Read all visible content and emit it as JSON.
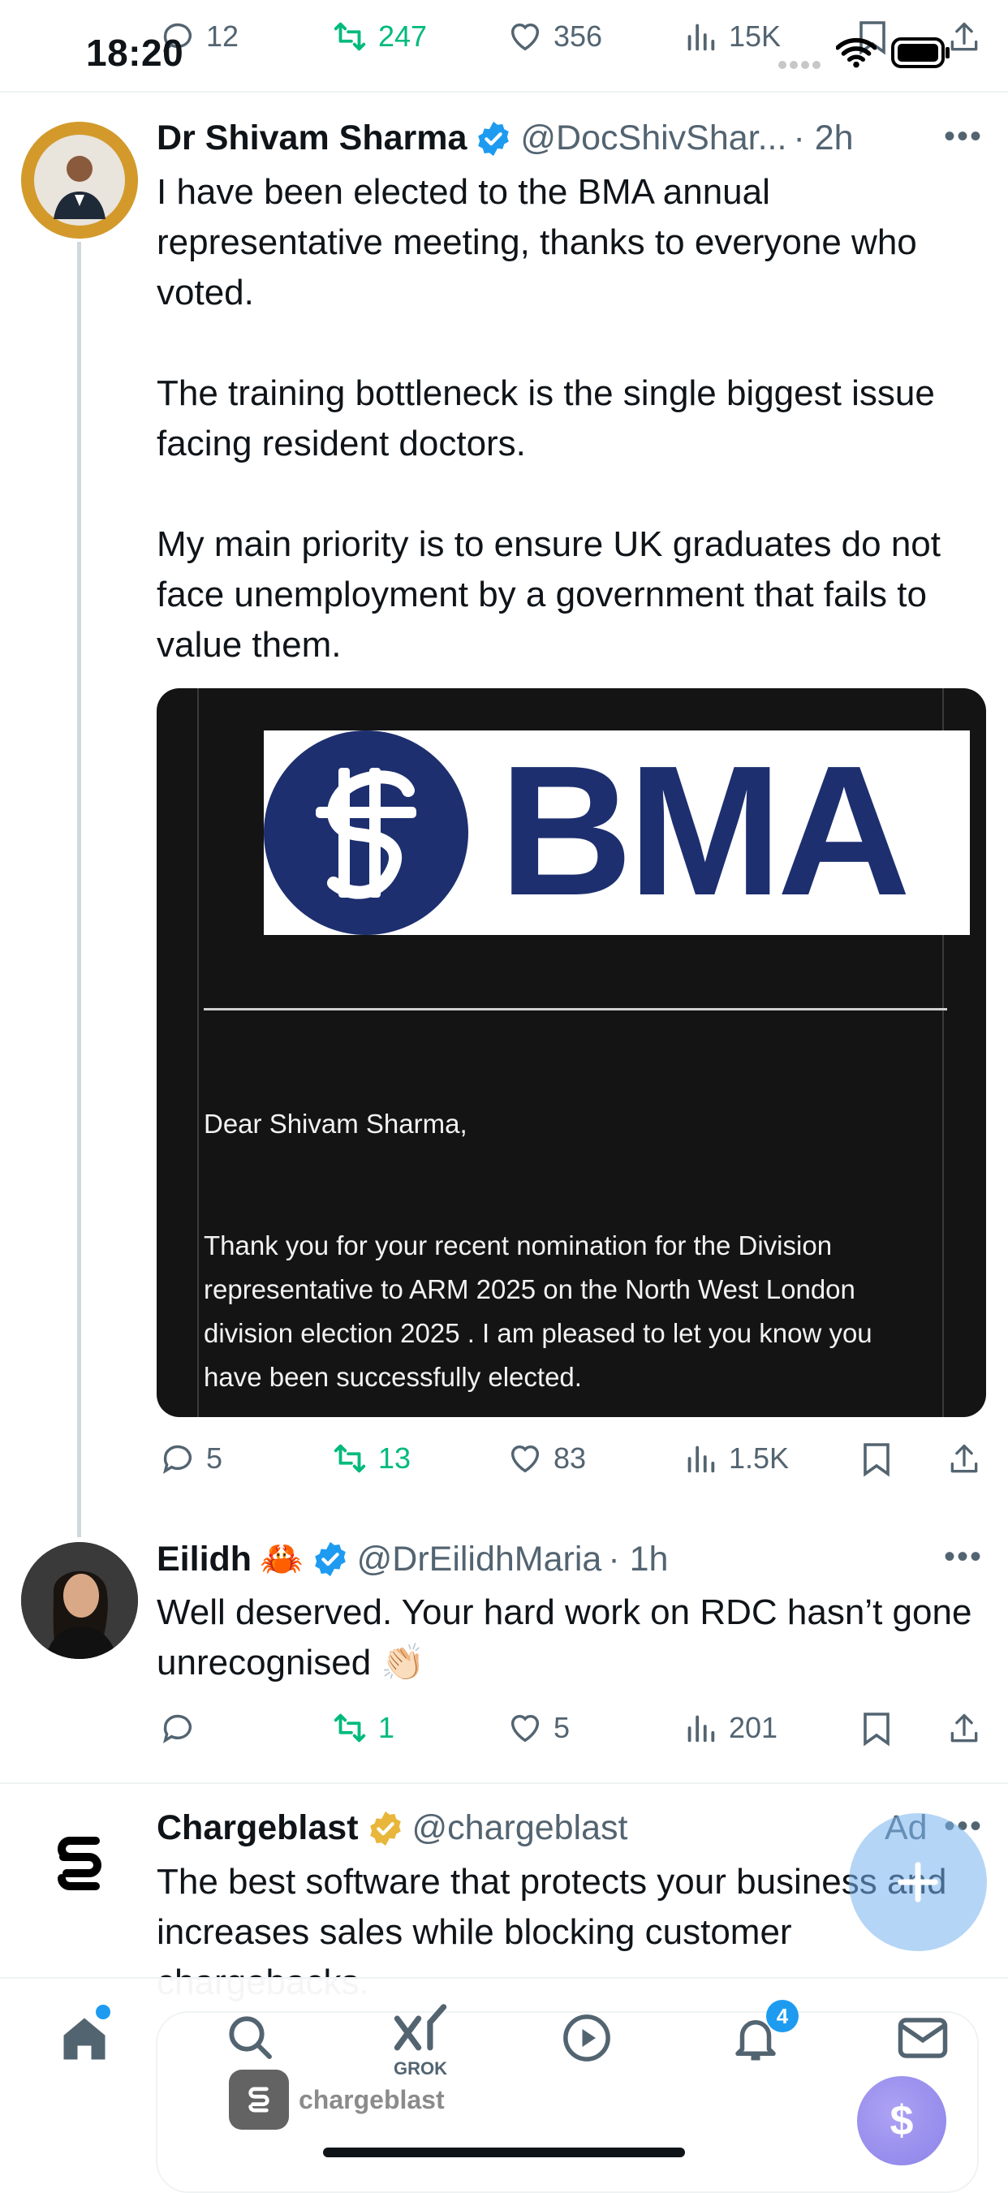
{
  "status_bar": {
    "time": "18:20"
  },
  "top_actions": {
    "replies": "12",
    "reposts": "247",
    "likes": "356",
    "views": "15K"
  },
  "posts": [
    {
      "name": "Dr Shivam Sharma",
      "handle": "@DocShivShar...",
      "time": "· 2h",
      "text": "I have been elected to the BMA annual representative meeting, thanks to everyone who voted.\n\nThe training bottleneck is the single biggest issue facing resident doctors.\n\nMy main priority is to ensure UK graduates do not face unemployment by a government that fails to value them.",
      "media": {
        "logo_text": "BMA",
        "greeting": "Dear Shivam Sharma,",
        "body_lines": [
          "Thank you for your recent nomination for the Division",
          "representative to ARM 2025 on the North West London",
          "division election 2025 . I am pleased to let you know you",
          "have been successfully elected."
        ]
      },
      "actions": {
        "replies": "5",
        "reposts": "13",
        "likes": "83",
        "views": "1.5K"
      }
    },
    {
      "name": "Eilidh",
      "emoji": "🦀",
      "handle": "@DrEilidhMaria",
      "time": "· 1h",
      "text": "Well deserved. Your hard work on RDC hasn’t gone unrecognised 👏🏻",
      "actions": {
        "replies": "",
        "reposts": "1",
        "likes": "5",
        "views": "201"
      }
    },
    {
      "name": "Chargeblast",
      "handle": "@chargeblast",
      "ad_label": "Ad",
      "text": "The best software that protects your business and increases sales while blocking customer chargebacks.",
      "brand": "chargeblast"
    }
  ],
  "nav": {
    "grok_label": "GROK",
    "notifications_badge": "4"
  },
  "colors": {
    "accent": "#1d9bf0",
    "repost_green": "#00ba7c",
    "bma_navy": "#1d2f6f",
    "verified_gold": "#e8b63b"
  }
}
